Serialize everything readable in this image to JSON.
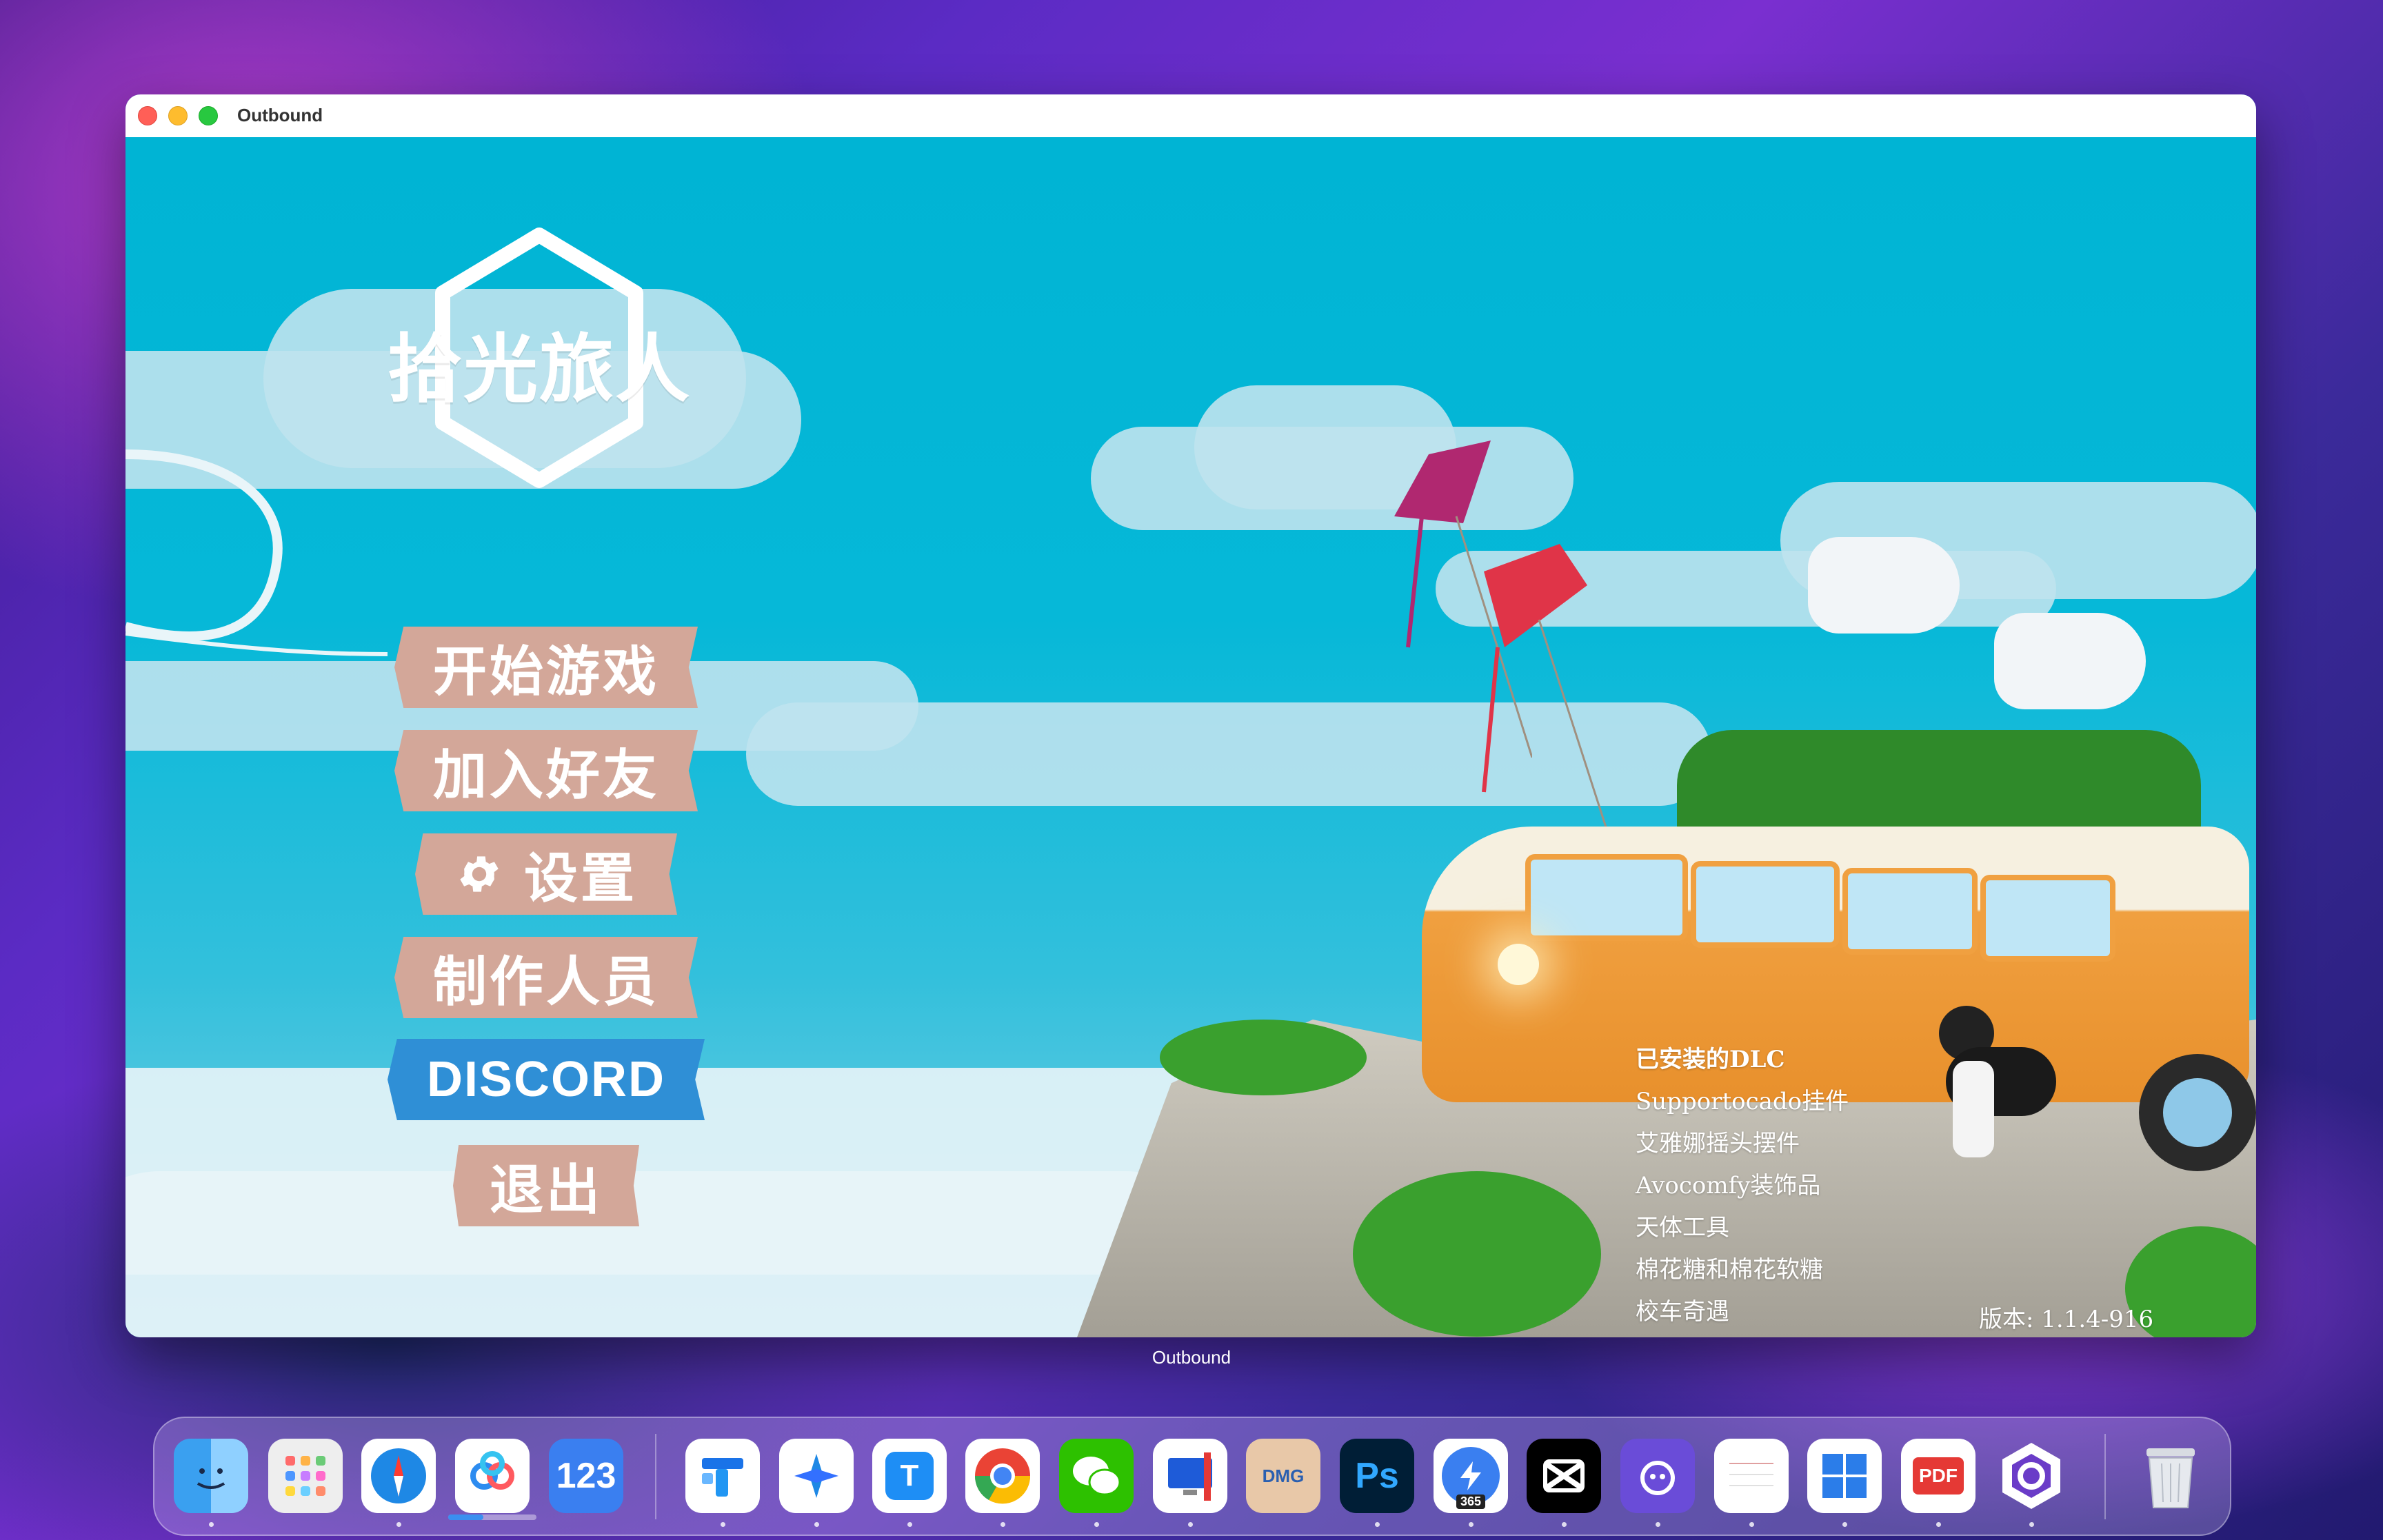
{
  "window": {
    "title": "Outbound"
  },
  "game": {
    "logo_text": "拾光旅人",
    "menu": {
      "start": "开始游戏",
      "join": "加入好友",
      "settings": "设置",
      "credits": "制作人员",
      "discord": "DISCORD",
      "quit": "退出"
    },
    "dlc": {
      "heading": "已安装的DLC",
      "items": [
        "Supportocado挂件",
        "艾雅娜摇头摆件",
        "Avocomfy装饰品",
        "天体工具",
        "棉花糖和棉花软糖",
        "校车奇遇"
      ]
    },
    "version": "版本: 1.1.4-916"
  },
  "dock": {
    "hover_label": "Outbound",
    "icons": {
      "numbers_text": "123",
      "tencent_text": "T",
      "photoshop_text": "Ps",
      "pdf_text": "PDF",
      "dmg_text": "DMG",
      "app365_text": "365"
    }
  },
  "colors": {
    "sky": "#00b5d6",
    "menu_button": "#d3a799",
    "discord_button": "#2f8fd6",
    "bus_orange": "#e8902c"
  }
}
